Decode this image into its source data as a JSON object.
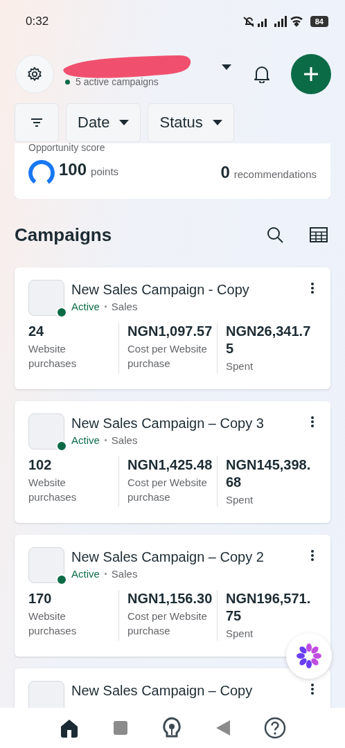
{
  "status_bar": {
    "time": "0:32",
    "battery": "84"
  },
  "header": {
    "subtitle": "5 active campaigns"
  },
  "filters": [
    {
      "kind": "icon"
    },
    {
      "kind": "dropdown",
      "label": "Date"
    },
    {
      "kind": "dropdown",
      "label": "Status"
    }
  ],
  "opportunity": {
    "label": "Opportunity score",
    "score": "100",
    "score_unit": "points",
    "recommendations": "0",
    "recommendations_unit": "recommendations"
  },
  "campaigns_title": "Campaigns",
  "campaigns": [
    {
      "name": "New Sales Campaign - Copy",
      "status": "Active",
      "type": "Sales",
      "metrics": [
        {
          "value": "24",
          "label": "Website purchases"
        },
        {
          "value": "NGN1,097.57",
          "label": "Cost per Website purchase"
        },
        {
          "value": "NGN26,341.75",
          "label": "Spent"
        }
      ]
    },
    {
      "name": "New Sales Campaign – Copy 3",
      "status": "Active",
      "type": "Sales",
      "metrics": [
        {
          "value": "102",
          "label": "Website purchases"
        },
        {
          "value": "NGN1,425.48",
          "label": "Cost per Website purchase"
        },
        {
          "value": "NGN145,398.68",
          "label": "Spent"
        }
      ]
    },
    {
      "name": "New Sales Campaign – Copy 2",
      "status": "Active",
      "type": "Sales",
      "metrics": [
        {
          "value": "170",
          "label": "Website purchases"
        },
        {
          "value": "NGN1,156.30",
          "label": "Cost per Website purchase"
        },
        {
          "value": "NGN196,571.75",
          "label": "Spent"
        }
      ]
    },
    {
      "name": "New Sales Campaign – Copy"
    }
  ],
  "nav": [
    {
      "kind": "home",
      "selected": true
    },
    {
      "kind": "square",
      "selected": false
    },
    {
      "kind": "bulb",
      "selected": false
    },
    {
      "kind": "back",
      "selected": false
    },
    {
      "kind": "help",
      "selected": false
    }
  ]
}
